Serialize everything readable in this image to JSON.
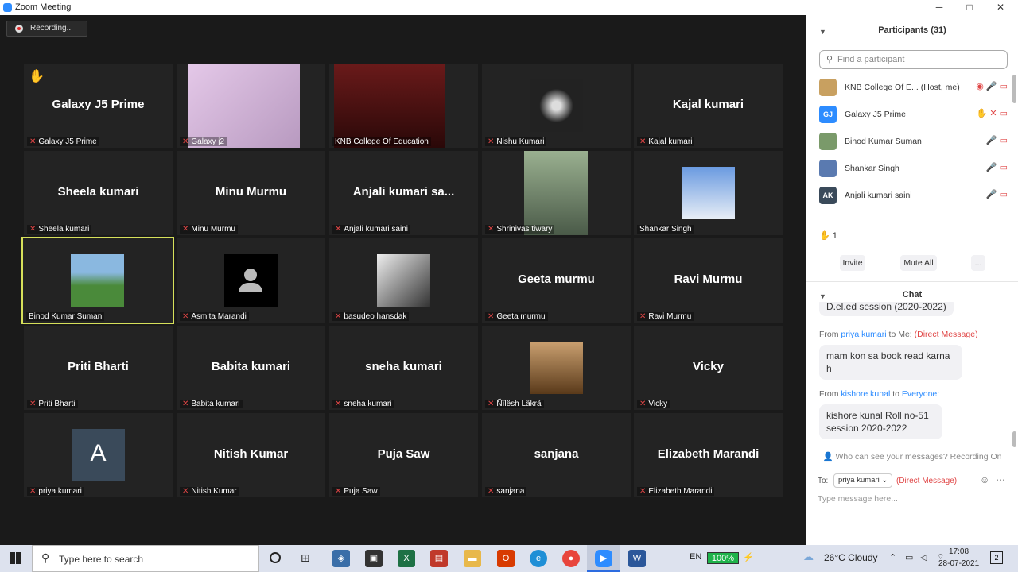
{
  "window": {
    "title": "Zoom Meeting",
    "minimize": "─",
    "maximize": "□",
    "close": "✕"
  },
  "recording": {
    "label": "Recording..."
  },
  "tiles": [
    {
      "big": "Galaxy J5 Prime",
      "label": "Galaxy J5 Prime",
      "muted": true,
      "hand": true
    },
    {
      "big": "",
      "label": "Galaxy j2",
      "muted": true,
      "photo": "person"
    },
    {
      "big": "",
      "label": "KNB College Of Education",
      "muted": false,
      "photo": "college"
    },
    {
      "big": "",
      "label": "Nishu Kumari",
      "muted": true,
      "photo": "flower"
    },
    {
      "big": "Kajal kumari",
      "label": "Kajal kumari",
      "muted": true
    },
    {
      "big": "Sheela kumari",
      "label": "Sheela kumari",
      "muted": true
    },
    {
      "big": "Minu Murmu",
      "label": "Minu Murmu",
      "muted": true
    },
    {
      "big": "Anjali kumari sa...",
      "label": "Anjali kumari saini",
      "muted": true
    },
    {
      "big": "",
      "label": "Shrinivas tiwary",
      "muted": true,
      "photo": "selfie"
    },
    {
      "big": "",
      "label": "Shankar Singh",
      "muted": false,
      "photo": "portrait"
    },
    {
      "big": "",
      "label": "Binod Kumar Suman",
      "muted": false,
      "photo": "field",
      "active": true
    },
    {
      "big": "",
      "label": "Asmita Marandi",
      "muted": true,
      "photo": "avatar"
    },
    {
      "big": "",
      "label": "basudeo hansdak",
      "muted": true,
      "photo": "bw"
    },
    {
      "big": "Geeta murmu",
      "label": "Geeta murmu",
      "muted": true
    },
    {
      "big": "Ravi Murmu",
      "label": "Ravi Murmu",
      "muted": true
    },
    {
      "big": "Priti Bharti",
      "label": "Priti Bharti",
      "muted": true
    },
    {
      "big": "Babita kumari",
      "label": "Babita kumari",
      "muted": true
    },
    {
      "big": "sneha kumari",
      "label": "sneha kumari",
      "muted": true
    },
    {
      "big": "",
      "label": "Ñïlësh Läkrä",
      "muted": true,
      "photo": "sunglasses"
    },
    {
      "big": "Vicky",
      "label": "Vicky",
      "muted": true
    },
    {
      "big": "",
      "label": "priya kumari",
      "muted": true,
      "photo": "letter",
      "letter": "A"
    },
    {
      "big": "Nitish Kumar",
      "label": "Nitish Kumar",
      "muted": true
    },
    {
      "big": "Puja Saw",
      "label": "Puja Saw",
      "muted": true
    },
    {
      "big": "sanjana",
      "label": "sanjana",
      "muted": true
    },
    {
      "big": "Elizabeth Marandi",
      "label": "Elizabeth Marandi",
      "muted": true
    }
  ],
  "participants": {
    "title": "Participants (31)",
    "search_placeholder": "Find a participant",
    "list": [
      {
        "initials": "",
        "name": "KNB College Of E...",
        "role": "(Host, me)",
        "color": "#c8a060"
      },
      {
        "initials": "GJ",
        "name": "Galaxy J5 Prime",
        "role": "",
        "color": "#2d8cff"
      },
      {
        "initials": "",
        "name": "Binod Kumar Suman",
        "role": "",
        "color": "#7a9a6a"
      },
      {
        "initials": "",
        "name": "Shankar Singh",
        "role": "",
        "color": "#5a7ab0"
      },
      {
        "initials": "AK",
        "name": "Anjali kumari saini",
        "role": "",
        "color": "#3a4a5a"
      }
    ],
    "raised_hands": "1",
    "invite": "Invite",
    "mute_all": "Mute All",
    "more": "..."
  },
  "chat": {
    "title": "Chat",
    "cut_text": "D.el.ed session (2020-2022)",
    "m1_from": "From",
    "m1_sender": "priya kumari",
    "m1_to": "to Me:",
    "m1_tag": "(Direct Message)",
    "m1_text": "mam kon sa book read karna h",
    "m2_from": "From",
    "m2_sender": "kishore kunal",
    "m2_to": "to",
    "m2_target": "Everyone:",
    "m2_text": "kishore kunal Roll no-51 session 2020-2022",
    "notice": "Who can see your messages? Recording On",
    "to_label": "To:",
    "to_value": "priya kumari",
    "to_tag": "(Direct Message)",
    "input_placeholder": "Type message here..."
  },
  "taskbar": {
    "search": "Type here to search",
    "lang": "EN",
    "battery": "100%",
    "weather": "26°C  Cloudy",
    "time": "17:08",
    "date": "28-07-2021",
    "notif_count": "2"
  }
}
